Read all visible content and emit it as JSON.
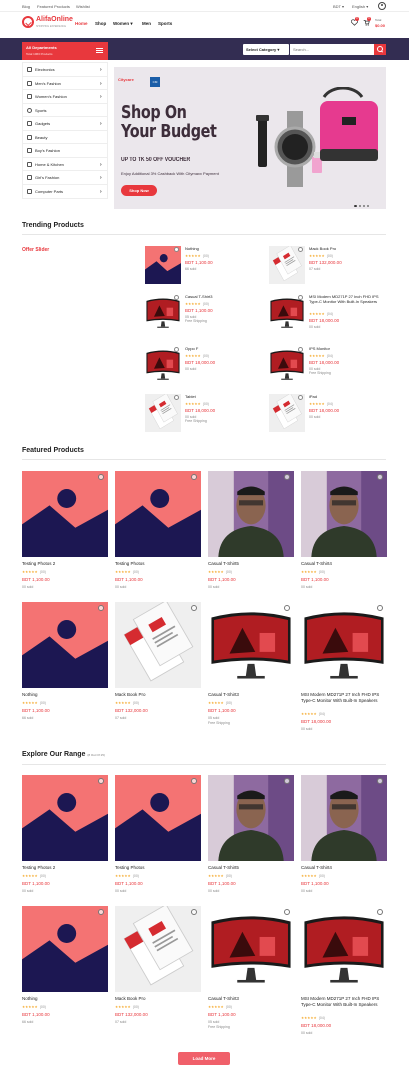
{
  "topbar": {
    "links": [
      "Blog",
      "Featured Products",
      "Wishlist"
    ],
    "currency": "BDT",
    "language": "English"
  },
  "header": {
    "logo": "AlifaOnline",
    "logo_sub": "SHOPPING EXPERIENCE",
    "nav": [
      "Home",
      "Shop",
      "Women",
      "Men",
      "Sports"
    ],
    "wishlist_count": "0",
    "cart_count": "0",
    "cart_total_label": "Total",
    "cart_total": "$0.00"
  },
  "departments": {
    "title": "All Departments",
    "subtitle": "Total 1063 Products",
    "items": [
      "Electronics",
      "Men's Fashion",
      "Women's Fashion",
      "Sports",
      "Gadgets",
      "Beauty",
      "Boy's Fashion",
      "Home & Kitchen",
      "Girl's Fashion",
      "Computer Parts"
    ]
  },
  "search": {
    "category_label": "Select Category",
    "placeholder": "Search..."
  },
  "banner": {
    "brand1": "Citycare",
    "brand2": "CM",
    "title_line1": "Shop On",
    "title_line2": "Your Budget",
    "subtitle": "UP TO TK 50 OFF VOUCHER",
    "small": "Enjoy Additional 3% Cashback With Citymaxx Payment",
    "button": "Shop Now"
  },
  "trending": {
    "title": "Trending Products",
    "offer": "Offer Slider",
    "items": [
      {
        "name": "Nothing",
        "reviews": "(00)",
        "price": "BDT 1,100.00",
        "sold": "66 sold",
        "free": "",
        "img": "ph"
      },
      {
        "name": "Mack Book Pro",
        "reviews": "(00)",
        "price": "BDT 132,000.00",
        "sold": "07 sold",
        "free": "",
        "img": "bc"
      },
      {
        "name": "Casual T-Shirt3",
        "reviews": "(00)",
        "price": "BDT 1,100.00",
        "sold": "05 sold",
        "free": "Free Shipping",
        "img": "mon"
      },
      {
        "name": "MSI Modern MD271P 27 Inch FHD IPS Type-C Monitor With Built-In Speakers",
        "reviews": "(04)",
        "price": "BDT 18,000.00",
        "sold": "00 sold",
        "free": "",
        "img": "mon"
      },
      {
        "name": "Oppo F",
        "reviews": "(00)",
        "price": "BDT 18,000.00",
        "sold": "00 sold",
        "free": "",
        "img": "mon"
      },
      {
        "name": "IPS Monitor",
        "reviews": "(04)",
        "price": "BDT 18,000.00",
        "sold": "00 sold",
        "free": "Free Shipping",
        "img": "mon"
      },
      {
        "name": "Tablet",
        "reviews": "(00)",
        "price": "BDT 18,000.00",
        "sold": "00 sold",
        "free": "Free Shipping",
        "img": "bc"
      },
      {
        "name": "iPad",
        "reviews": "(04)",
        "price": "BDT 18,000.00",
        "sold": "00 sold",
        "free": "",
        "img": "bc"
      }
    ]
  },
  "featured": {
    "title": "Featured Products",
    "items": [
      {
        "name": "Testing Photos 2",
        "reviews": "(00)",
        "price": "BDT 1,100.00",
        "sold": "00 sold",
        "free": "",
        "img": "ph"
      },
      {
        "name": "Testing Photos",
        "reviews": "(00)",
        "price": "BDT 1,100.00",
        "sold": "00 sold",
        "free": "",
        "img": "ph"
      },
      {
        "name": "Casual T-Shirt5",
        "reviews": "(00)",
        "price": "BDT 1,100.00",
        "sold": "00 sold",
        "free": "",
        "img": "por"
      },
      {
        "name": "Casual T-Shirt4",
        "reviews": "(00)",
        "price": "BDT 1,100.00",
        "sold": "00 sold",
        "free": "",
        "img": "por"
      },
      {
        "name": "Nothing",
        "reviews": "(00)",
        "price": "BDT 1,100.00",
        "sold": "66 sold",
        "free": "",
        "img": "ph"
      },
      {
        "name": "Mack Book Pro",
        "reviews": "(00)",
        "price": "BDT 132,000.00",
        "sold": "07 sold",
        "free": "",
        "img": "bc"
      },
      {
        "name": "Casual T-Shirt3",
        "reviews": "(00)",
        "price": "BDT 1,100.00",
        "sold": "05 sold",
        "free": "Free Shipping",
        "img": "mon"
      },
      {
        "name": "MSI Modern MD271P 27 Inch FHD IPS Type-C Monitor With Built-In Speakers",
        "reviews": "(04)",
        "price": "BDT 18,000.00",
        "sold": "00 sold",
        "free": "",
        "img": "mon"
      }
    ]
  },
  "explore": {
    "title": "Explore Our Range",
    "subtitle": "(8 Out Of 15)",
    "items": [
      {
        "name": "Testing Photos 2",
        "reviews": "(00)",
        "price": "BDT 1,100.00",
        "sold": "00 sold",
        "free": "",
        "img": "ph"
      },
      {
        "name": "Testing Photos",
        "reviews": "(00)",
        "price": "BDT 1,100.00",
        "sold": "00 sold",
        "free": "",
        "img": "ph"
      },
      {
        "name": "Casual T-Shirt5",
        "reviews": "(00)",
        "price": "BDT 1,100.00",
        "sold": "00 sold",
        "free": "",
        "img": "por"
      },
      {
        "name": "Casual T-Shirt4",
        "reviews": "(00)",
        "price": "BDT 1,100.00",
        "sold": "00 sold",
        "free": "",
        "img": "por"
      },
      {
        "name": "Nothing",
        "reviews": "(00)",
        "price": "BDT 1,100.00",
        "sold": "66 sold",
        "free": "",
        "img": "ph"
      },
      {
        "name": "Mack Book Pro",
        "reviews": "(00)",
        "price": "BDT 132,000.00",
        "sold": "07 sold",
        "free": "",
        "img": "bc"
      },
      {
        "name": "Casual T-Shirt3",
        "reviews": "(00)",
        "price": "BDT 1,100.00",
        "sold": "05 sold",
        "free": "Free Shipping",
        "img": "mon"
      },
      {
        "name": "MSI Modern MD271P 27 Inch FHD IPS Type-C Monitor With Built-In Speakers",
        "reviews": "(04)",
        "price": "BDT 18,000.00",
        "sold": "00 sold",
        "free": "",
        "img": "mon"
      }
    ]
  },
  "load_more": "Load More",
  "colors": {
    "accent": "#e8383d",
    "header_strip": "#332d52",
    "star": "#f5a623"
  }
}
